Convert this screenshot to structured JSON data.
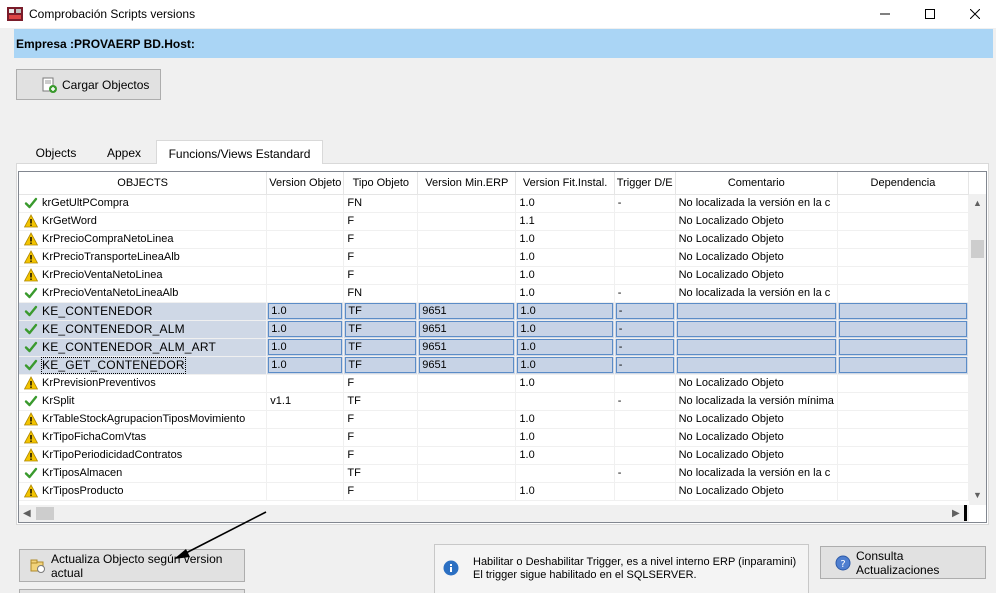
{
  "window": {
    "title": "Comprobación Scripts versions"
  },
  "banner": {
    "text": "Empresa :PROVAERP BD.Host:"
  },
  "buttons": {
    "load": "Cargar Objectos",
    "update": "Actualiza Objecto según version actual",
    "consult": "Consulta Actualizaciones"
  },
  "tabs": [
    "Objects",
    "Appex",
    "Funcions/Views Estandard"
  ],
  "grid": {
    "columns": [
      "OBJECTS",
      "Version Objeto",
      "Tipo Objeto",
      "Version Min.ERP",
      "Version Fit.Instal.",
      "Trigger D/E",
      "Comentario",
      "Dependencia"
    ],
    "rows": [
      {
        "status": "ok",
        "name": "krGetUltPCompra",
        "ver": "",
        "tipo": "FN",
        "min": "",
        "fit": "1.0",
        "trig": "-",
        "com": "No localizada la versión en la c",
        "dep": "",
        "sel": false
      },
      {
        "status": "warn",
        "name": "KrGetWord",
        "ver": "",
        "tipo": "F",
        "min": "",
        "fit": "1.1",
        "trig": "",
        "com": "No Localizado Objeto",
        "dep": "",
        "sel": false
      },
      {
        "status": "warn",
        "name": "KrPrecioCompraNetoLinea",
        "ver": "",
        "tipo": "F",
        "min": "",
        "fit": "1.0",
        "trig": "",
        "com": "No Localizado Objeto",
        "dep": "",
        "sel": false
      },
      {
        "status": "warn",
        "name": "KrPrecioTransporteLineaAlb",
        "ver": "",
        "tipo": "F",
        "min": "",
        "fit": "1.0",
        "trig": "",
        "com": "No Localizado Objeto",
        "dep": "",
        "sel": false
      },
      {
        "status": "warn",
        "name": "KrPrecioVentaNetoLinea",
        "ver": "",
        "tipo": "F",
        "min": "",
        "fit": "1.0",
        "trig": "",
        "com": "No Localizado Objeto",
        "dep": "",
        "sel": false
      },
      {
        "status": "ok",
        "name": "KrPrecioVentaNetoLineaAlb",
        "ver": "",
        "tipo": "FN",
        "min": "",
        "fit": "1.0",
        "trig": "-",
        "com": "No localizada la versión en la c",
        "dep": "",
        "sel": false
      },
      {
        "status": "ok",
        "name": "KE_CONTENEDOR",
        "ver": "1.0",
        "tipo": "TF",
        "min": "9651",
        "fit": "1.0",
        "trig": "-",
        "com": "",
        "dep": "",
        "sel": true
      },
      {
        "status": "ok",
        "name": "KE_CONTENEDOR_ALM",
        "ver": "1.0",
        "tipo": "TF",
        "min": "9651",
        "fit": "1.0",
        "trig": "-",
        "com": "",
        "dep": "",
        "sel": true
      },
      {
        "status": "ok",
        "name": "KE_CONTENEDOR_ALM_ART",
        "ver": "1.0",
        "tipo": "TF",
        "min": "9651",
        "fit": "1.0",
        "trig": "-",
        "com": "",
        "dep": "",
        "sel": true
      },
      {
        "status": "ok",
        "name": "KE_GET_CONTENEDOR",
        "ver": "1.0",
        "tipo": "TF",
        "min": "9651",
        "fit": "1.0",
        "trig": "-",
        "com": "",
        "dep": "",
        "sel": true,
        "focus": true
      },
      {
        "status": "warn",
        "name": "KrPrevisionPreventivos",
        "ver": "",
        "tipo": "F",
        "min": "",
        "fit": "1.0",
        "trig": "",
        "com": "No Localizado Objeto",
        "dep": "",
        "sel": false
      },
      {
        "status": "ok",
        "name": "KrSplit",
        "ver": "v1.1",
        "tipo": "TF",
        "min": "",
        "fit": "",
        "trig": "-",
        "com": "No localizada la versión mínima",
        "dep": "",
        "sel": false
      },
      {
        "status": "warn",
        "name": "KrTableStockAgrupacionTiposMovimiento",
        "ver": "",
        "tipo": "F",
        "min": "",
        "fit": "1.0",
        "trig": "",
        "com": "No Localizado Objeto",
        "dep": "",
        "sel": false
      },
      {
        "status": "warn",
        "name": "KrTipoFichaComVtas",
        "ver": "",
        "tipo": "F",
        "min": "",
        "fit": "1.0",
        "trig": "",
        "com": "No Localizado Objeto",
        "dep": "",
        "sel": false
      },
      {
        "status": "warn",
        "name": "KrTipoPeriodicidadContratos",
        "ver": "",
        "tipo": "F",
        "min": "",
        "fit": "1.0",
        "trig": "",
        "com": "No Localizado Objeto",
        "dep": "",
        "sel": false
      },
      {
        "status": "ok",
        "name": "KrTiposAlmacen",
        "ver": "",
        "tipo": "TF",
        "min": "",
        "fit": "",
        "trig": "-",
        "com": "No localizada la versión en la c",
        "dep": "",
        "sel": false
      },
      {
        "status": "warn",
        "name": "KrTiposProducto",
        "ver": "",
        "tipo": "F",
        "min": "",
        "fit": "1.0",
        "trig": "",
        "com": "No Localizado Objeto",
        "dep": "",
        "sel": false
      }
    ]
  },
  "info": {
    "line1": "Habilitar o Deshabilitar Trigger, es a nivel interno ERP (inparamini)",
    "line2": "El trigger sigue habilitado en el SQLSERVER."
  },
  "colors": {
    "banner": "#aad5f5",
    "selection": "#cfd8e6",
    "ok": "#3a9a2e",
    "warn": "#f3c400"
  },
  "icons": {
    "ok": "check-icon",
    "warn": "warning-icon",
    "info": "info-icon"
  }
}
